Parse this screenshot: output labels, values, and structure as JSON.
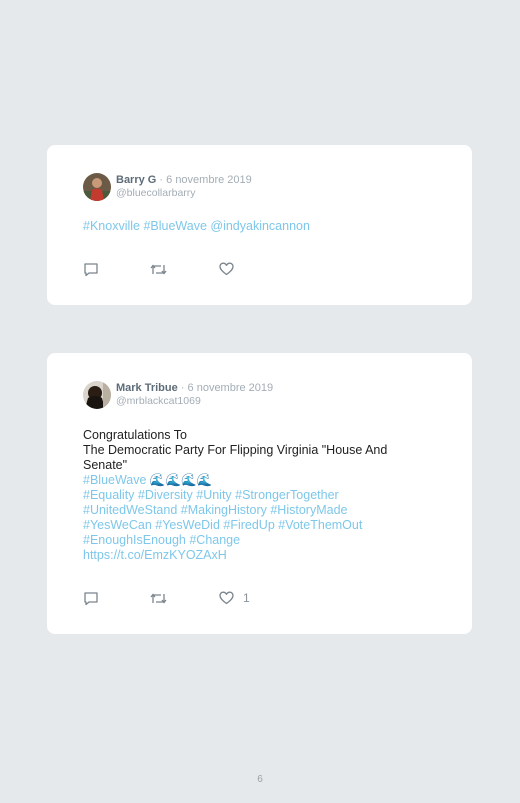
{
  "tweets": [
    {
      "author": "Barry G",
      "date": "· 6 novembre 2019",
      "handle": "@bluecollarbarry",
      "text_lines": [],
      "hashtag_lines": [
        "#Knoxville #BlueWave @indyakincannon"
      ],
      "like_count": ""
    },
    {
      "author": "Mark Tribue",
      "date": "· 6 novembre 2019",
      "handle": "@mrblackcat1069",
      "text_lines": [
        "Congratulations To",
        "The Democratic Party For Flipping Virginia \"House And",
        "Senate\""
      ],
      "hashtag_lines": [
        "#BlueWave 🌊🌊🌊🌊",
        "#Equality #Diversity #Unity #StrongerTogether",
        "#UnitedWeStand #MakingHistory #HistoryMade",
        "#YesWeCan #YesWeDid #FiredUp #VoteThemOut",
        "#EnoughIsEnough #Change",
        "https://t.co/EmzKYOZAxH"
      ],
      "like_count": "1"
    }
  ],
  "icons": [
    "reply-icon",
    "retweet-icon",
    "like-icon"
  ],
  "colors": {
    "link": "#7ec7ea",
    "background": "#e6e9eb",
    "card": "#ffffff",
    "icon": "#7b858d"
  },
  "page_number": "6"
}
